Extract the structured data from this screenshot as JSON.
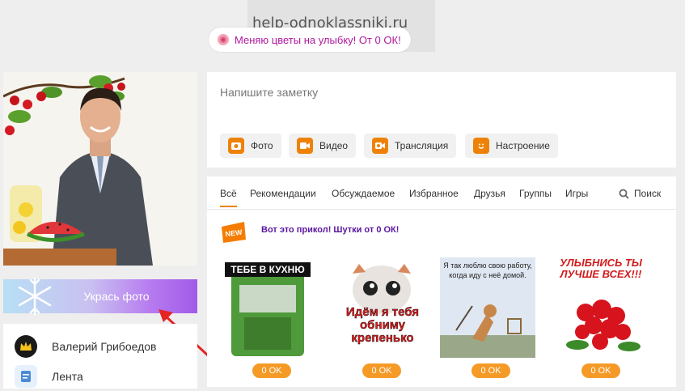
{
  "watermark": "help-odnoklassniki.ru",
  "promo": {
    "text": "Меняю цветы на улыбку! От 0 ОК!"
  },
  "profile": {
    "decorate_label": "Укрась фото"
  },
  "menu": [
    {
      "label": "Валерий Грибоедов"
    },
    {
      "label": "Лента"
    }
  ],
  "note": {
    "placeholder": "Напишите заметку",
    "actions": [
      {
        "label": "Фото",
        "icon": "camera-icon"
      },
      {
        "label": "Видео",
        "icon": "video-icon"
      },
      {
        "label": "Трансляция",
        "icon": "broadcast-icon"
      },
      {
        "label": "Настроение",
        "icon": "smile-icon"
      }
    ]
  },
  "feed": {
    "tabs": [
      "Всё",
      "Рекомендации",
      "Обсуждаемое",
      "Избранное",
      "Друзья",
      "Группы",
      "Игры"
    ],
    "search_label": "Поиск",
    "promo_title": "Вот это прикол! Шутки от 0 ОК!",
    "new_badge": "NEW",
    "stickers": [
      {
        "caption": "ТЕБЕ В КУХНЮ",
        "price": "0 OK"
      },
      {
        "caption": "Идём я тебя обниму крепенько",
        "price": "0 OK"
      },
      {
        "caption": "Я так люблю свою работу, когда иду с неё домой.",
        "price": "0 OK"
      },
      {
        "caption": "УЛЫБНИСЬ ТЫ ЛУЧШЕ ВСЕХ!!!",
        "price": "0 OK"
      }
    ]
  },
  "colors": {
    "accent": "#ee8208",
    "promo_text": "#b0189e",
    "price": "#f59a27"
  }
}
